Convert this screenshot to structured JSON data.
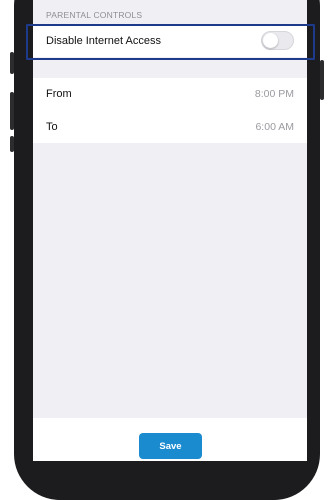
{
  "section": {
    "header": "PARENTAL CONTROLS"
  },
  "toggle_row": {
    "label": "Disable Internet Access",
    "state": "off"
  },
  "schedule": [
    {
      "label": "From",
      "value": "8:00 PM"
    },
    {
      "label": "To",
      "value": "6:00 AM"
    }
  ],
  "actions": {
    "save_label": "Save"
  },
  "colors": {
    "accent": "#1b8bd0",
    "highlight_box": "#1e3a8a"
  }
}
